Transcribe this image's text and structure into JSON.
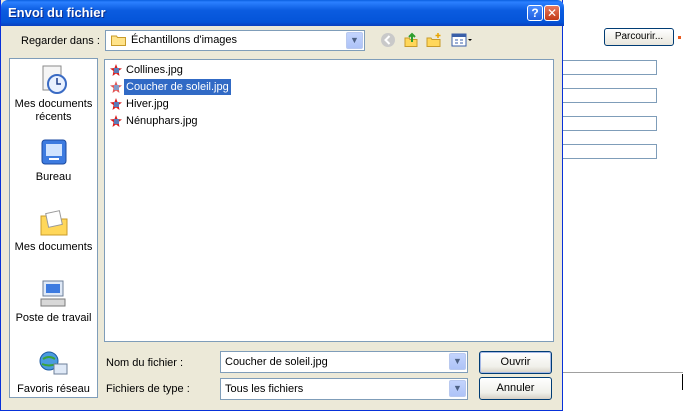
{
  "dialog": {
    "title": "Envoi du fichier",
    "help_glyph": "?",
    "close_glyph": "✕"
  },
  "lookin": {
    "label": "Regarder dans :",
    "value": "Échantillons d'images"
  },
  "places": [
    {
      "label": "Mes documents récents",
      "icon": "recent-documents-icon"
    },
    {
      "label": "Bureau",
      "icon": "desktop-icon"
    },
    {
      "label": "Mes documents",
      "icon": "my-documents-icon"
    },
    {
      "label": "Poste de travail",
      "icon": "my-computer-icon"
    },
    {
      "label": "Favoris réseau",
      "icon": "network-places-icon"
    }
  ],
  "files": [
    {
      "name": "Collines.jpg",
      "selected": false
    },
    {
      "name": "Coucher de soleil.jpg",
      "selected": true
    },
    {
      "name": "Hiver.jpg",
      "selected": false
    },
    {
      "name": "Nénuphars.jpg",
      "selected": false
    }
  ],
  "filename": {
    "label": "Nom du fichier :",
    "value": "Coucher de soleil.jpg"
  },
  "filetype": {
    "label": "Fichiers de type :",
    "value": "Tous les fichiers"
  },
  "buttons": {
    "open": "Ouvrir",
    "cancel": "Annuler"
  },
  "background": {
    "browse_label": "Parcourir..."
  },
  "colors": {
    "titlebar": "#0454d8",
    "dialog_bg": "#ece9d8",
    "selection": "#316ac5"
  }
}
